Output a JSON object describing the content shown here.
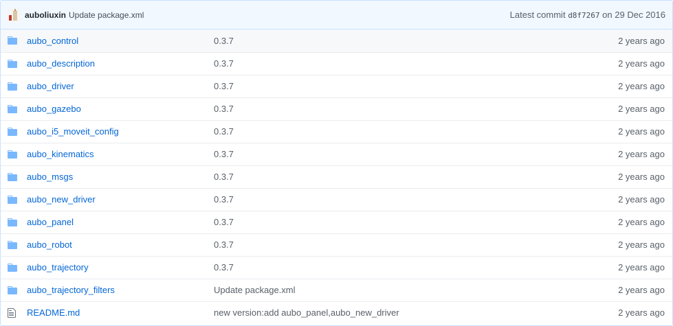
{
  "commit": {
    "author": "auboliuxin",
    "message": "Update package.xml",
    "latest_label": "Latest commit",
    "sha": "d8f7267",
    "on_label": "on",
    "date": "29 Dec 2016"
  },
  "colors": {
    "link": "#0366d6",
    "folder_icon": "#79b8ff",
    "header_bg": "#f1f8ff"
  },
  "files": [
    {
      "name": "aubo_control",
      "type": "folder-icon",
      "message": "0.3.7",
      "age": "2 years ago"
    },
    {
      "name": "aubo_description",
      "type": "folder-icon",
      "message": "0.3.7",
      "age": "2 years ago"
    },
    {
      "name": "aubo_driver",
      "type": "folder-icon",
      "message": "0.3.7",
      "age": "2 years ago"
    },
    {
      "name": "aubo_gazebo",
      "type": "folder-icon",
      "message": "0.3.7",
      "age": "2 years ago"
    },
    {
      "name": "aubo_i5_moveit_config",
      "type": "folder-icon",
      "message": "0.3.7",
      "age": "2 years ago"
    },
    {
      "name": "aubo_kinematics",
      "type": "folder-icon",
      "message": "0.3.7",
      "age": "2 years ago"
    },
    {
      "name": "aubo_msgs",
      "type": "folder-icon",
      "message": "0.3.7",
      "age": "2 years ago"
    },
    {
      "name": "aubo_new_driver",
      "type": "folder-icon",
      "message": "0.3.7",
      "age": "2 years ago"
    },
    {
      "name": "aubo_panel",
      "type": "folder-icon",
      "message": "0.3.7",
      "age": "2 years ago"
    },
    {
      "name": "aubo_robot",
      "type": "folder-icon",
      "message": "0.3.7",
      "age": "2 years ago"
    },
    {
      "name": "aubo_trajectory",
      "type": "folder-icon",
      "message": "0.3.7",
      "age": "2 years ago"
    },
    {
      "name": "aubo_trajectory_filters",
      "type": "folder-icon",
      "message": "Update package.xml",
      "age": "2 years ago"
    },
    {
      "name": "README.md",
      "type": "file-text-icon",
      "message": "new version:add aubo_panel,aubo_new_driver",
      "age": "2 years ago"
    }
  ]
}
